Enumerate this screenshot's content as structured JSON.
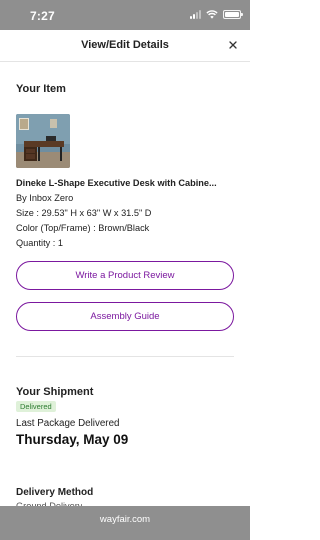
{
  "status_bar": {
    "time": "7:27"
  },
  "sheet": {
    "title": "View/Edit Details",
    "close_label": "×"
  },
  "item": {
    "section_title": "Your Item",
    "product_name": "Dineke L-Shape Executive Desk with Cabine...",
    "brand": "By Inbox Zero",
    "size": "Size : 29.53\" H x 63\" W x 31.5\" D",
    "color": "Color (Top/Frame) : Brown/Black",
    "quantity": "Quantity : 1",
    "review_button": "Write a Product Review",
    "assembly_button": "Assembly Guide"
  },
  "shipment": {
    "section_title": "Your Shipment",
    "status_badge": "Delivered",
    "last_label": "Last Package Delivered",
    "date": "Thursday, May 09"
  },
  "delivery": {
    "section_title": "Delivery Method",
    "method_partial": "Ground Delivery"
  },
  "browser": {
    "url": "wayfair.com"
  },
  "colors": {
    "accent": "#7b189f",
    "badge_bg": "#dff1d9",
    "badge_text": "#2e7d32",
    "chrome_gray": "#8f8f8f"
  }
}
